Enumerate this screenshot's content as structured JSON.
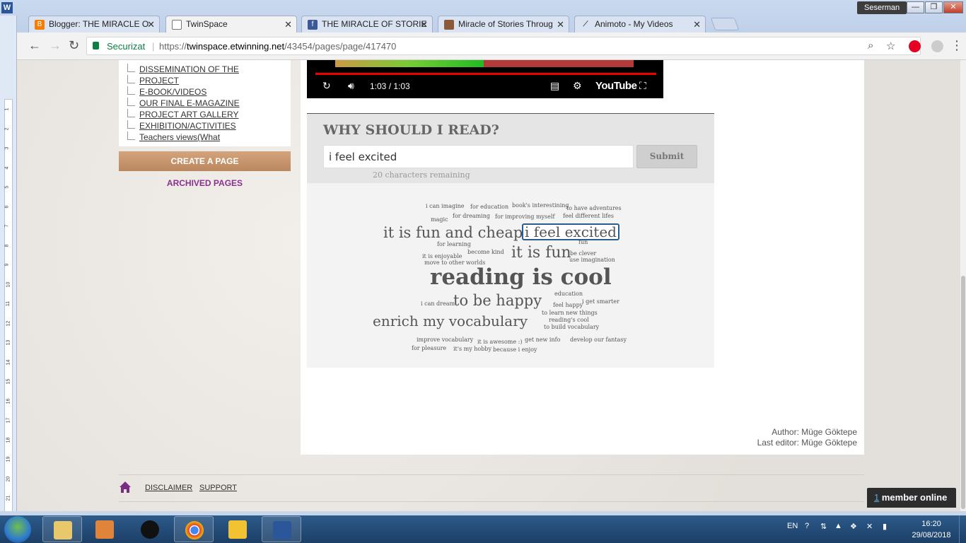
{
  "window": {
    "app_letter": "W",
    "user_badge": "Seserman",
    "minimize": "—",
    "restore": "❐",
    "close": "✕"
  },
  "tabs": [
    {
      "label": "Blogger: THE MIRACLE O",
      "icon": "blogger-icon",
      "color": "#f57d00"
    },
    {
      "label": "TwinSpace",
      "icon": "page-icon",
      "color": "#ffffff"
    },
    {
      "label": "THE MIRACLE OF STORIE",
      "icon": "facebook-icon",
      "color": "#3b5998"
    },
    {
      "label": "Miracle of Stories Throug",
      "icon": "photo-icon",
      "color": "#8a5a3a"
    },
    {
      "label": "Animoto - My Videos",
      "icon": "animoto-icon",
      "color": "#555555"
    }
  ],
  "toolbar": {
    "secure_label": "Securizat",
    "url_prefix": "https://",
    "url_domain": "twinspace.etwinning.net",
    "url_path": "/43454/pages/page/417470"
  },
  "word_ruler": [
    "1",
    "2",
    "3",
    "4",
    "5",
    "6",
    "7",
    "8",
    "9",
    "10",
    "11",
    "12",
    "13",
    "14",
    "15",
    "16",
    "17",
    "18",
    "19",
    "20",
    "21"
  ],
  "sidebar": {
    "items": [
      "DISSEMINATION OF THE",
      "PROJECT",
      "E-BOOK/VIDEOS",
      "OUR FINAL E-MAGAZINE",
      "PROJECT ART GALLERY",
      "EXHIBITION/ACTIVITIES",
      "Teachers views(What"
    ],
    "create_page": "CREATE A PAGE",
    "archived": "ARCHIVED PAGES"
  },
  "video": {
    "time": "1:03 / 1:03",
    "youtube": "YouTube",
    "progress": 1.0
  },
  "poll": {
    "title": "WHY SHOULD I READ?",
    "input_value": "i feel excited",
    "submit": "Submit",
    "remaining": "20 characters remaining"
  },
  "cloud": {
    "words": [
      {
        "t": "i can imagine",
        "size": 8
      },
      {
        "t": "for education",
        "size": 8
      },
      {
        "t": "book's interestining",
        "size": 8
      },
      {
        "t": "to have adventures",
        "size": 8
      },
      {
        "t": "magic",
        "size": 8
      },
      {
        "t": "for dreaming",
        "size": 8
      },
      {
        "t": "for improving myself",
        "size": 8
      },
      {
        "t": "feel different lifes",
        "size": 8
      },
      {
        "t": "it is fun and cheap",
        "size": 21
      },
      {
        "t": "i feel excited",
        "size": 21,
        "selected": true
      },
      {
        "t": "for learning",
        "size": 8
      },
      {
        "t": "fun",
        "size": 8
      },
      {
        "t": "become kind",
        "size": 8
      },
      {
        "t": "it is fun",
        "size": 22
      },
      {
        "t": "be clever",
        "size": 8
      },
      {
        "t": "it is enjoyable",
        "size": 8
      },
      {
        "t": "use imagination",
        "size": 8
      },
      {
        "t": "move to other worlds",
        "size": 8
      },
      {
        "t": "reading is cool",
        "size": 32
      },
      {
        "t": "education",
        "size": 8
      },
      {
        "t": "to be happy",
        "size": 22
      },
      {
        "t": "i get smarter",
        "size": 8
      },
      {
        "t": "i can dream",
        "size": 8
      },
      {
        "t": "feel happy",
        "size": 8
      },
      {
        "t": "to learn new things",
        "size": 8
      },
      {
        "t": "enrich my vocabulary",
        "size": 21
      },
      {
        "t": "reading's cool",
        "size": 8
      },
      {
        "t": "to build vocabulary",
        "size": 8
      },
      {
        "t": "improve vocabulary",
        "size": 8
      },
      {
        "t": "it is awesome :)",
        "size": 8
      },
      {
        "t": "get new info",
        "size": 8
      },
      {
        "t": "develop our fantasy",
        "size": 8
      },
      {
        "t": "for pleasure",
        "size": 8
      },
      {
        "t": "it's my hobby",
        "size": 8
      },
      {
        "t": "because i enjoy",
        "size": 8
      }
    ]
  },
  "meta": {
    "author": "Author: Müge Göktepe",
    "last_editor": "Last editor: Müge Göktepe"
  },
  "footer": {
    "disclaimer": "DISCLAIMER",
    "support": "SUPPORT",
    "online_count": "1",
    "online_text": " member online"
  },
  "taskbar": {
    "lang": "EN",
    "time": "16:20",
    "date": "29/08/2018"
  },
  "colors": {
    "accent_secure": "#0b8043",
    "create_page_bg": "#c89670",
    "archived_link": "#8a2f8f",
    "selected_word_border": "#2b5e8f"
  }
}
